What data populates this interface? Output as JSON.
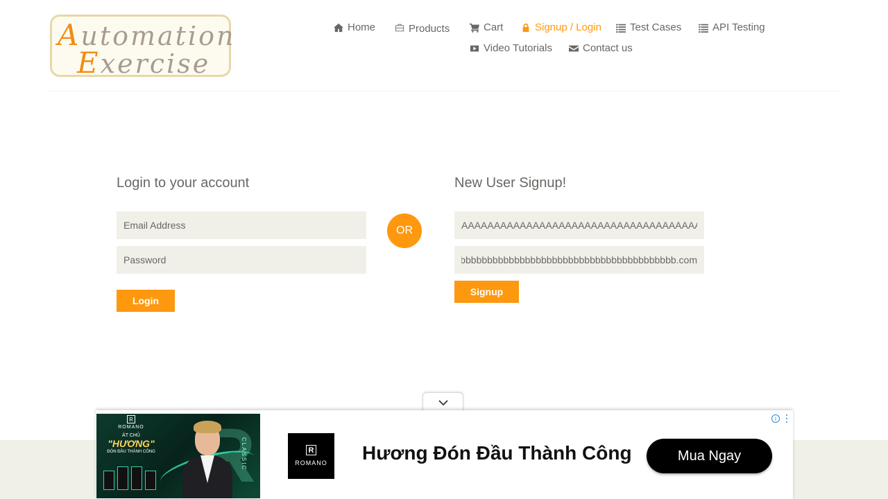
{
  "logo": {
    "line1_cap": "A",
    "line1_rest": "utomation",
    "line2_cap": "E",
    "line2_rest": "xercise"
  },
  "nav": {
    "home": "Home",
    "products": "Products",
    "cart": "Cart",
    "signup_login": "Signup / Login",
    "test_cases": "Test Cases",
    "api_testing": "API Testing",
    "video_tutorials": "Video Tutorials",
    "contact_us": "Contact us"
  },
  "login": {
    "title": "Login to your account",
    "email_placeholder": "Email Address",
    "password_placeholder": "Password",
    "button": "Login"
  },
  "or_label": "OR",
  "signup": {
    "title": "New User Signup!",
    "name_value": "AAAAAAAAAAAAAAAAAAAAAAAAAAAAAAAAAAAAAA",
    "email_value": "bbbbbbbbbbbbbbbbbbbbbbbbbbbbbbbbbbbbbbbbbbbbbbb.com",
    "button": "Signup"
  },
  "ad": {
    "image_brand": "ROMANO",
    "image_line1": "ÁT CHỦ",
    "image_line2": "\"HƯƠNG\"",
    "image_line3": "ĐÓN ĐẦU THÀNH CÔNG",
    "image_vertical": "CLASSIC",
    "logo_letter": "R",
    "logo_name": "ROMANO",
    "headline": "Hương Đón Đầu Thành Công",
    "cta": "Mua Ngay",
    "info_symbol": "i"
  },
  "colors": {
    "accent": "#FE980F",
    "text": "#696763",
    "field_bg": "#F0F0E9"
  },
  "icons": {
    "home": "home-icon",
    "products": "briefcase-icon",
    "cart": "cart-icon",
    "signup_login": "lock-icon",
    "test_cases": "list-icon",
    "api_testing": "list-icon",
    "video_tutorials": "youtube-play-icon",
    "contact_us": "envelope-icon",
    "ad_toggle": "chevron-down-icon"
  }
}
